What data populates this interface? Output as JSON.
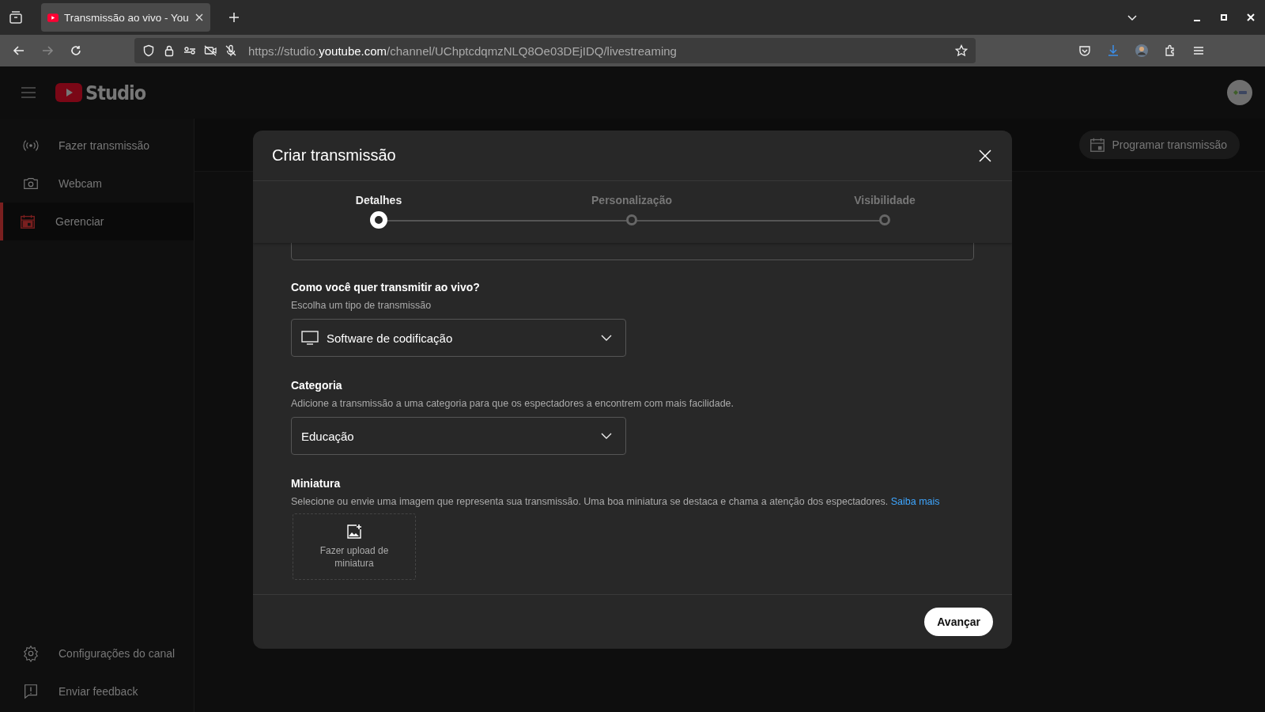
{
  "browser": {
    "tab": {
      "title": "Transmissão ao vivo - You",
      "selected": true
    },
    "url": {
      "prefix": "https://studio.",
      "domain": "youtube.com",
      "path": "/channel/UChptcdqmzNLQ8Oe03DEjIDQ/livestreaming"
    }
  },
  "studio": {
    "logo_text": "Studio",
    "sidebar": {
      "items": [
        {
          "label": "Fazer transmissão",
          "selected": false
        },
        {
          "label": "Webcam",
          "selected": false
        },
        {
          "label": "Gerenciar",
          "selected": true
        }
      ],
      "bottom_items": [
        {
          "label": "Configurações do canal"
        },
        {
          "label": "Enviar feedback"
        }
      ]
    },
    "schedule_button": "Programar transmissão"
  },
  "dialog": {
    "title": "Criar transmissão",
    "steps": [
      {
        "label": "Detalhes",
        "selected": true
      },
      {
        "label": "Personalização",
        "selected": false
      },
      {
        "label": "Visibilidade",
        "selected": false
      }
    ],
    "sections": [
      {
        "kind": "select",
        "heading": "Como você quer transmitir ao vivo?",
        "description": "Escolha um tipo de transmissão",
        "value": "Software de codificação"
      },
      {
        "kind": "select",
        "heading": "Categoria",
        "description": "Adicione a transmissão a uma categoria para que os espectadores a encontrem com mais facilidade.",
        "value": "Educação"
      },
      {
        "kind": "upload",
        "heading": "Miniatura",
        "description": "Selecione ou envie uma imagem que representa sua transmissão. Uma boa miniatura se destaca e chama a atenção dos espectadores.",
        "link": "Saiba mais",
        "upload_label": "Fazer upload de miniatura"
      }
    ],
    "next_button": "Avançar"
  }
}
